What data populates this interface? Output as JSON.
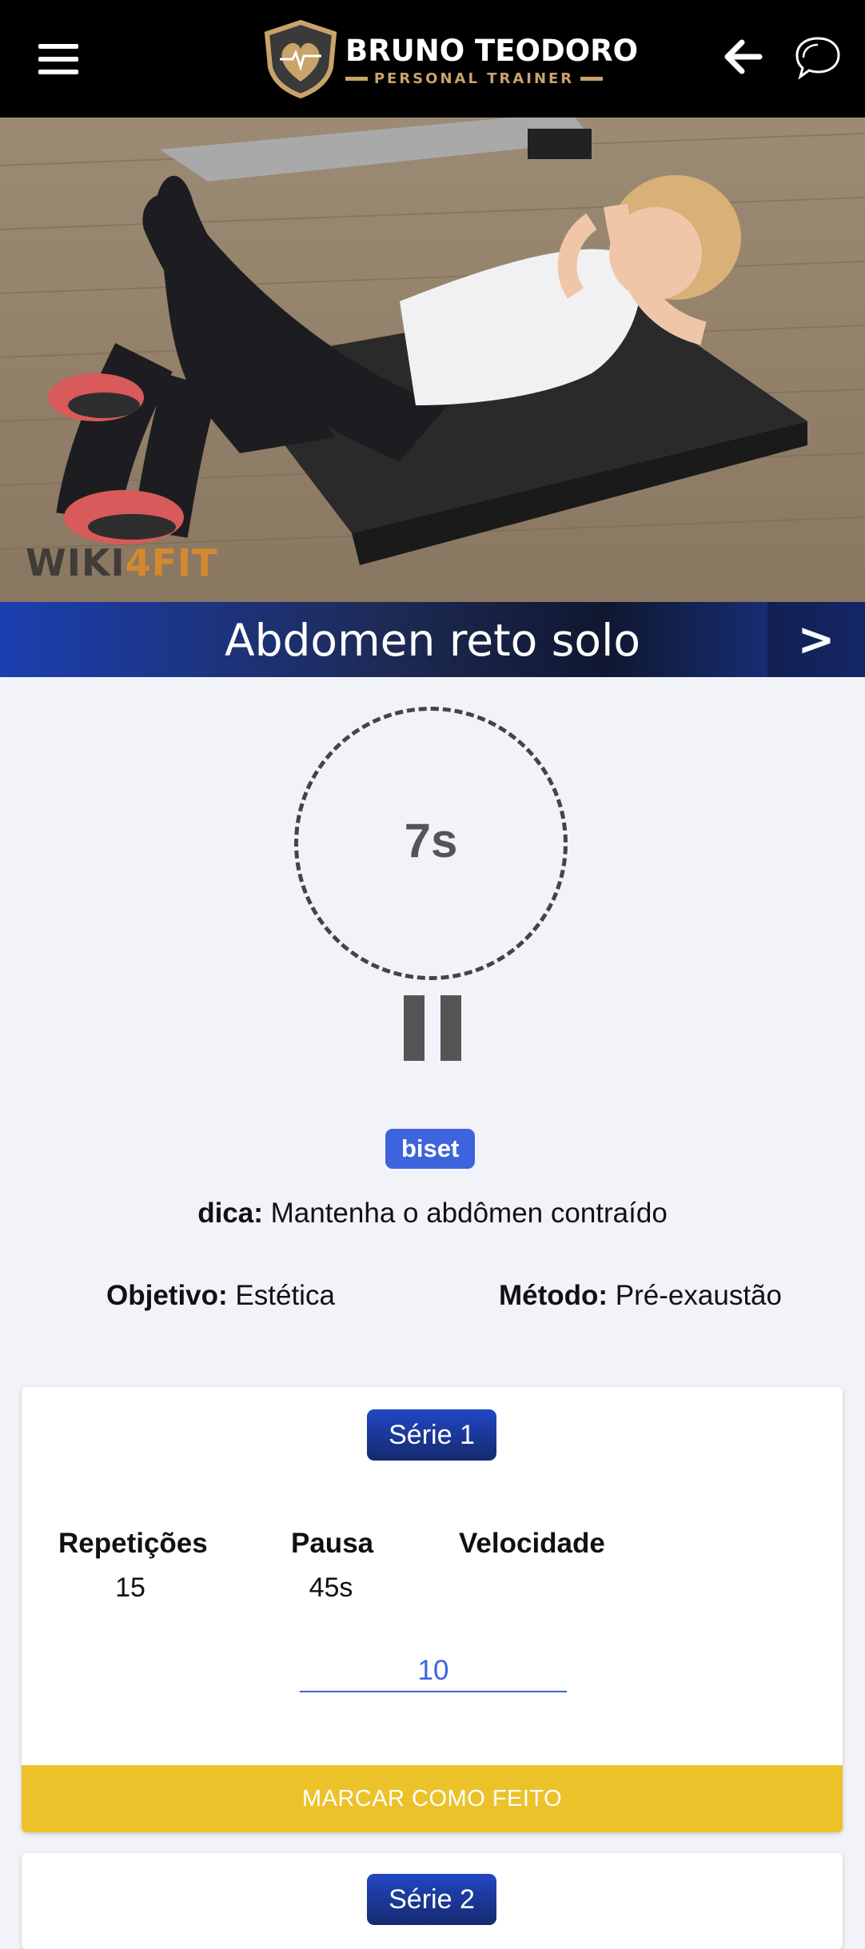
{
  "header": {
    "brand_name": "BRUNO TEODORO",
    "brand_subtitle": "PERSONAL TRAINER",
    "icons": [
      "menu-icon",
      "back-arrow-icon",
      "chat-icon"
    ]
  },
  "media": {
    "watermark_part1": "WIKI",
    "watermark_part2": "4FIT"
  },
  "exercise": {
    "title": "Abdomen reto solo",
    "next_label": ">",
    "timer": "7s",
    "badge": "biset",
    "tip_label": "dica:",
    "tip_text": " Mantenha o abdômen contraído",
    "objective_label": "Objetivo:",
    "objective_value": " Estética",
    "method_label": "Método:",
    "method_value": " Pré-exaustão"
  },
  "series": [
    {
      "label": "Série 1",
      "reps_label": "Repetições",
      "reps_value": "15",
      "pause_label": "Pausa",
      "pause_value": "45s",
      "speed_label": "Velocidade",
      "speed_input_value": "10",
      "done_label": "MARCAR COMO FEITO"
    },
    {
      "label": "Série 2"
    }
  ],
  "colors": {
    "accent_blue": "#3d63dd",
    "done_yellow": "#ecc22b",
    "header_bg": "#000000",
    "page_bg": "#f2f3f8"
  }
}
